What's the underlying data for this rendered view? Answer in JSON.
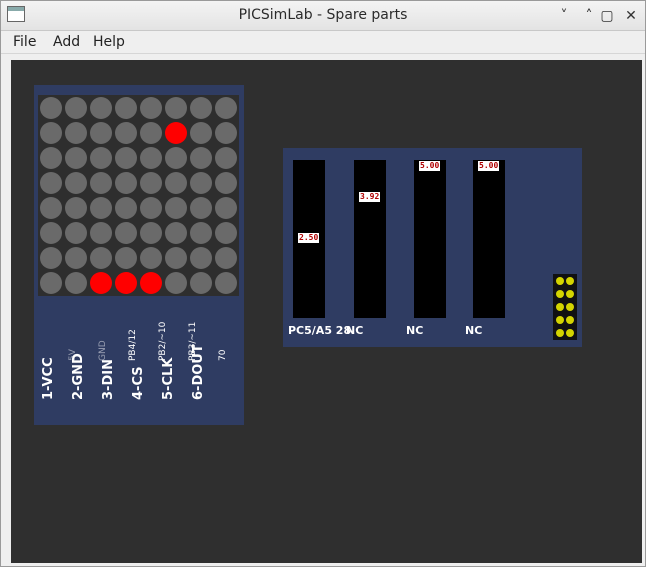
{
  "window": {
    "title": "PICSimLab - Spare parts"
  },
  "window_controls": [
    "˅",
    "˄",
    "▢",
    "✕"
  ],
  "menubar": {
    "items": [
      "File",
      "Add",
      "Help"
    ]
  },
  "led_matrix": {
    "color_on": "#ff0000",
    "color_off": "#6a6a6a",
    "lit": [
      [
        1,
        5
      ],
      [
        7,
        2
      ],
      [
        7,
        3
      ],
      [
        7,
        4
      ]
    ],
    "pins": [
      {
        "label": "1-VCC",
        "signal": "5V",
        "signal_dim": true
      },
      {
        "label": "2-GND",
        "signal": "GND",
        "signal_dim": true
      },
      {
        "label": "3-DIN",
        "signal": "PB4/12",
        "signal_dim": false
      },
      {
        "label": "4-CS",
        "signal": "PB2/~10",
        "signal_dim": false
      },
      {
        "label": "5-CLK",
        "signal": "PB3/~11",
        "signal_dim": false
      },
      {
        "label": "6-DOUT",
        "signal": "70",
        "signal_dim": false
      }
    ]
  },
  "voltmeter": {
    "slots": [
      {
        "value": "2.50",
        "label": "PC5/A5 28",
        "level": 0.5
      },
      {
        "value": "3.92",
        "label": "NC",
        "level": 0.784
      },
      {
        "value": "5.00",
        "label": "NC",
        "level": 1.0
      },
      {
        "value": "5.00",
        "label": "NC",
        "level": 1.0
      }
    ]
  }
}
